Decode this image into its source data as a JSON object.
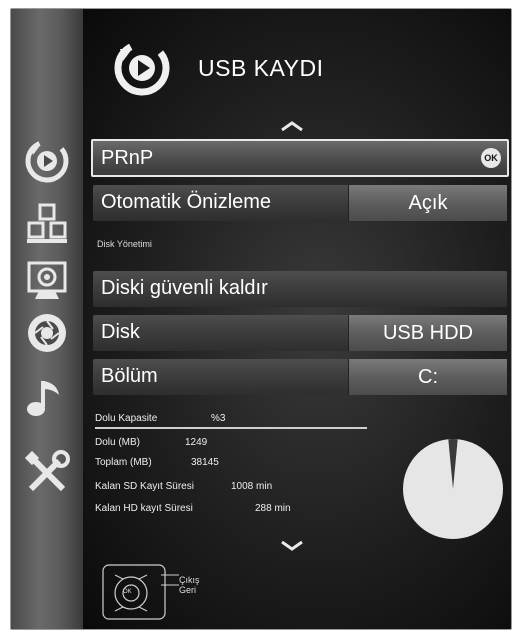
{
  "header": {
    "title": "USB KAYDI"
  },
  "sidebar": {
    "items": [
      {
        "icon": "record-icon"
      },
      {
        "icon": "blocks-icon"
      },
      {
        "icon": "image-settings-icon"
      },
      {
        "icon": "aperture-icon"
      },
      {
        "icon": "music-note-icon"
      },
      {
        "icon": "tools-icon"
      }
    ]
  },
  "menu": {
    "prnp": {
      "label": "PRnP",
      "ok": "OK"
    },
    "preview": {
      "label": "Otomatik Önizleme",
      "value": "Açık"
    },
    "section_label": "Disk Yönetimi",
    "safe_remove": {
      "label": "Diski güvenli kaldır"
    },
    "disk": {
      "label": "Disk",
      "value": "USB HDD"
    },
    "partition": {
      "label": "Bölüm",
      "value": "C:"
    }
  },
  "info": {
    "capacity_label": "Dolu Kapasite",
    "capacity_value": "%3",
    "used_label": "Dolu (MB)",
    "used_value": "1249",
    "total_label": "Toplam (MB)",
    "total_value": "38145",
    "sd_label": "Kalan SD Kayıt Süresi",
    "sd_value": "1008 min",
    "hd_label": "Kalan HD kayıt Süresi",
    "hd_value": "288 min"
  },
  "legend": {
    "exit": "Çıkış",
    "back": "Geri",
    "ok": "OK"
  },
  "pie_used_fraction": 0.03,
  "colors": {
    "pie_free": "#e6e6e6",
    "pie_used": "#3a3a3a",
    "row_value": "#6a6a6a"
  }
}
